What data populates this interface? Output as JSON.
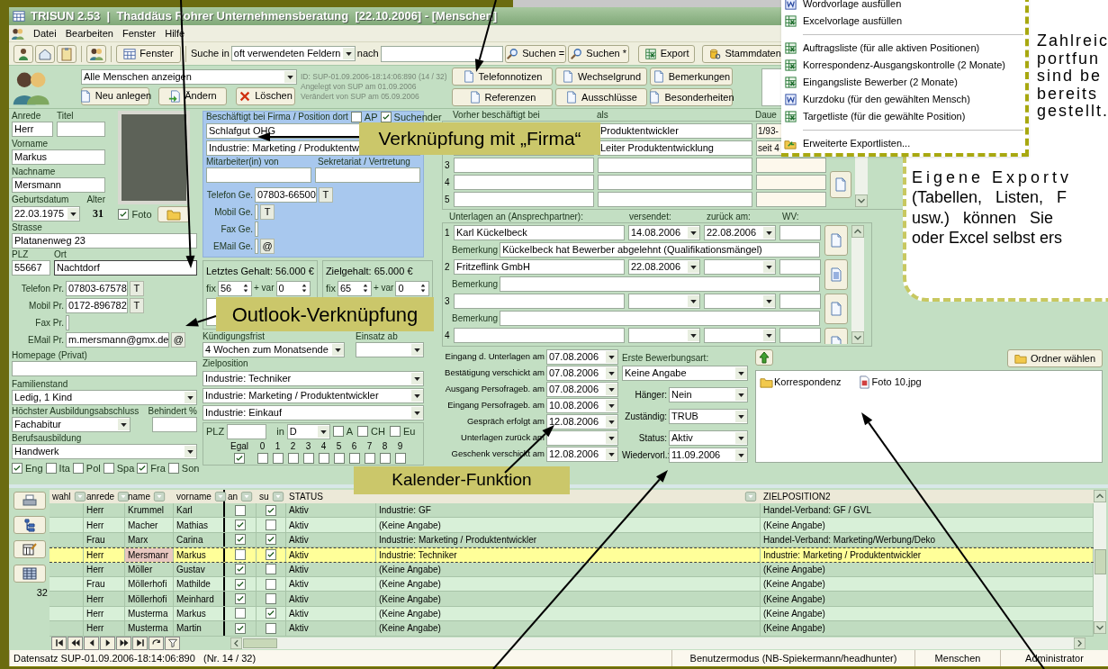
{
  "window": {
    "title": "TRISUN 2.53  |  Thaddäus Rohrer Unternehmensberatung  [22.10.2006] - [Menschen]"
  },
  "menu": [
    "Datei",
    "Bearbeiten",
    "Fenster",
    "Hilfe"
  ],
  "toolbar": {
    "fenster_button": "Fenster",
    "search_in_label": "Suche in",
    "search_in_value": "oft verwendeten Feldern",
    "search_for_label": "nach",
    "buttons": [
      {
        "label": "Suchen =",
        "kind": "search"
      },
      {
        "label": "Suchen *",
        "kind": "search"
      },
      {
        "label": "Export",
        "kind": "sheet"
      },
      {
        "label": "Stammdaten",
        "kind": "database"
      }
    ]
  },
  "record_bar": {
    "filter": "Alle Menschen anzeigen",
    "actions": [
      {
        "label": "Neu anlegen",
        "kind": "new"
      },
      {
        "label": "Ändern",
        "kind": "edit"
      },
      {
        "label": "Löschen",
        "kind": "delete"
      }
    ],
    "info": [
      "ID: SUP-01.09.2006-18:14:06:890  (14 / 32)",
      "Angelegt von SUP am 01.09.2006",
      "Verändert von SUP am 05.09.2006"
    ],
    "note_buttons": [
      "Telefonnotizen",
      "Wechselgrund",
      "Bemerkungen",
      "Referenzen",
      "Ausschlüsse",
      "Besonderheiten"
    ]
  },
  "person": {
    "anrede": {
      "label": "Anrede",
      "value": "Herr"
    },
    "titel": {
      "label": "Titel"
    },
    "vorname": {
      "label": "Vorname",
      "value": "Markus"
    },
    "nachname": {
      "label": "Nachname",
      "value": "Mersmann"
    },
    "geburtsdatum": {
      "label": "Geburtsdatum",
      "value": "22.03.1975"
    },
    "alter": {
      "label": "Alter",
      "value": "31"
    },
    "foto": {
      "label": "Foto",
      "checked": true
    },
    "strasse": {
      "label": "Strasse",
      "value": "Platanenweg 23"
    },
    "plz": {
      "label": "PLZ",
      "value": "55667"
    },
    "ort": {
      "label": "Ort",
      "value": "Nachtdorf"
    },
    "contacts": [
      {
        "label": "Telefon Pr.",
        "value": "07803-67578",
        "action": "T"
      },
      {
        "label": "Mobil Pr.",
        "value": "0172-896782",
        "action": "T"
      },
      {
        "label": "Fax Pr."
      },
      {
        "label": "EMail Pr.",
        "value": "m.mersmann@gmx.de",
        "action": "@"
      }
    ],
    "homepage": {
      "label": "Homepage (Privat)"
    },
    "familienstand": {
      "label": "Familienstand",
      "value": "Ledig, 1 Kind"
    },
    "abschluss": {
      "label": "Höchster Ausbildungsabschluss",
      "value": "Fachabitur"
    },
    "behindert": {
      "label": "Behindert %"
    },
    "berufsausbildung": {
      "label": "Berufsausbildung",
      "value": "Handwerk"
    },
    "languages": [
      {
        "label": "Eng",
        "checked": true
      },
      {
        "label": "Ita",
        "checked": false
      },
      {
        "label": "Pol",
        "checked": false
      },
      {
        "label": "Spa",
        "checked": false
      },
      {
        "label": "Fra",
        "checked": true
      },
      {
        "label": "Son",
        "checked": false
      }
    ]
  },
  "employer": {
    "header": "Beschäftigt bei Firma / Position dort",
    "ap": {
      "label": "AP",
      "checked": false
    },
    "suchender": {
      "label": "Suchender",
      "checked": true
    },
    "firma": "Schlafgut OHG",
    "position": "Industrie: Marketing / Produktentw",
    "mitarbeiter_label": "Mitarbeiter(in) von",
    "sekretariat_label": "Sekretariat / Vertretung",
    "contacts": [
      {
        "label": "Telefon Ge.",
        "value": "07803-66500",
        "action": "T"
      },
      {
        "label": "Mobil Ge.",
        "action": "T"
      },
      {
        "label": "Fax Ge."
      },
      {
        "label": "EMail Ge.",
        "action": "@"
      }
    ]
  },
  "salary": [
    {
      "title": "Letztes Gehalt: 56.000 €",
      "fix_label": "fix",
      "fix": "56",
      "var_label": "+ var",
      "var": "0"
    },
    {
      "title": "Zielgehalt: 65.000 €",
      "fix_label": "fix",
      "fix": "65",
      "var_label": "+ var",
      "var": "0"
    }
  ],
  "kuendigung": {
    "label": "Kündigungsfrist",
    "value": "4 Wochen zum Monatsende"
  },
  "einsatz": {
    "label": "Einsatz ab"
  },
  "zielposition": {
    "label": "Zielposition",
    "values": [
      "Industrie: Techniker",
      "Industrie: Marketing / Produktentwickler",
      "Industrie: Einkauf"
    ]
  },
  "region": {
    "plz_label": "PLZ",
    "in_label": "in",
    "country": "D",
    "areas": [
      {
        "label": "A",
        "checked": false
      },
      {
        "label": "CH",
        "checked": false
      },
      {
        "label": "Eu",
        "checked": false
      }
    ],
    "digits": [
      {
        "label": "Egal",
        "checked": true
      },
      {
        "label": "0",
        "checked": false
      },
      {
        "label": "1",
        "checked": false
      },
      {
        "label": "2",
        "checked": false
      },
      {
        "label": "3",
        "checked": false
      },
      {
        "label": "4",
        "checked": false
      },
      {
        "label": "5",
        "checked": false
      },
      {
        "label": "6",
        "checked": false
      },
      {
        "label": "7",
        "checked": false
      },
      {
        "label": "8",
        "checked": false
      },
      {
        "label": "9",
        "checked": false
      }
    ]
  },
  "previous_jobs": {
    "headers": [
      "Vorher beschäftigt bei",
      "als",
      "Daue"
    ],
    "rows": [
      {
        "als": "Produktentwickler",
        "dauer": "1/93-"
      },
      {
        "als": "Leiter Produktentwicklung",
        "dauer": "seit 4"
      },
      {
        "number": "3"
      },
      {
        "number": "4"
      },
      {
        "number": "5"
      }
    ]
  },
  "documents": {
    "headers": [
      "Unterlagen an (Ansprechpartner):",
      "versendet:",
      "zurück am:",
      "WV:"
    ],
    "rows": [
      {
        "number": "1",
        "recipient": "Karl Kückelbeck",
        "sent": "14.08.2006",
        "returned": "22.08.2006",
        "remark_label": "Bemerkung",
        "remark": "Kückelbeck hat Bewerber abgelehnt (Qualifikationsmängel)"
      },
      {
        "number": "2",
        "recipient": "Fritzeflink GmbH",
        "sent": "22.08.2006",
        "remark_label": "Bemerkung"
      },
      {
        "number": "3",
        "remark_label": "Bemerkung"
      },
      {
        "number": "4"
      }
    ]
  },
  "dates": [
    {
      "label": "Eingang d. Unterlagen am",
      "value": "07.08.2006"
    },
    {
      "label": "Bestätigung verschickt am",
      "value": "07.08.2006"
    },
    {
      "label": "Ausgang Persofrageb. am",
      "value": "07.08.2006"
    },
    {
      "label": "Eingang Persofrageb. am",
      "value": "10.08.2006"
    },
    {
      "label": "Gespräch erfolgt am",
      "value": "12.08.2006"
    },
    {
      "label": "Unterlagen zurück am"
    },
    {
      "label": "Geschenk verschickt am",
      "value": "12.08.2006"
    }
  ],
  "application": {
    "type_label": "Erste Bewerbungsart:",
    "type": "Keine Angabe",
    "fields": [
      {
        "label": "Hänger:",
        "value": "Nein"
      },
      {
        "label": "Zuständig:",
        "value": "TRUB"
      },
      {
        "label": "Status:",
        "value": "Aktiv"
      },
      {
        "label": "Wiedervorl.:",
        "value": "11.09.2006"
      }
    ]
  },
  "files": {
    "folder_button": "Ordner wählen",
    "items": [
      {
        "name": "Korrespondenz",
        "kind": "folder"
      },
      {
        "name": "Foto 10.jpg",
        "kind": "image"
      }
    ]
  },
  "grid": {
    "count": "32",
    "columns": [
      {
        "label": "wahl",
        "filter": true
      },
      {
        "label": "anrede",
        "filter": true
      },
      {
        "label": "name",
        "filter": true
      },
      {
        "label": "vorname",
        "filter": true
      },
      {
        "label": "an",
        "filter": true
      },
      {
        "label": "su",
        "filter": true
      },
      {
        "label": "STATUS",
        "filter": false
      },
      {
        "filter": true
      },
      {
        "label": "ZIELPOSITION2",
        "filter": false
      }
    ],
    "rows": [
      {
        "anrede": "Herr",
        "name": "Krummel",
        "vorname": "Karl",
        "an": false,
        "su": true,
        "status": "Aktiv",
        "column_8": "Industrie: GF",
        "zielposition2": "Handel-Verband: GF / GVL",
        "selected": false
      },
      {
        "anrede": "Herr",
        "name": "Macher",
        "vorname": "Mathias",
        "an": true,
        "su": false,
        "status": "Aktiv",
        "column_8": "(Keine Angabe)",
        "zielposition2": "(Keine Angabe)",
        "selected": false
      },
      {
        "anrede": "Frau",
        "name": "Marx",
        "vorname": "Carina",
        "an": true,
        "su": true,
        "status": "Aktiv",
        "column_8": "Industrie: Marketing / Produktentwickler",
        "zielposition2": "Handel-Verband: Marketing/Werbung/Deko",
        "selected": false
      },
      {
        "anrede": "Herr",
        "name": "Mersmanr",
        "vorname": "Markus",
        "an": false,
        "su": true,
        "status": "Aktiv",
        "column_8": "Industrie: Techniker",
        "zielposition2": "Industrie: Marketing / Produktentwickler",
        "selected": true
      },
      {
        "anrede": "Herr",
        "name": "Möller",
        "vorname": "Gustav",
        "an": true,
        "su": false,
        "status": "Aktiv",
        "column_8": "(Keine Angabe)",
        "zielposition2": "(Keine Angabe)",
        "selected": false
      },
      {
        "anrede": "Frau",
        "name": "Möllerhofi",
        "vorname": "Mathilde",
        "an": true,
        "su": false,
        "status": "Aktiv",
        "column_8": "(Keine Angabe)",
        "zielposition2": "(Keine Angabe)",
        "selected": false
      },
      {
        "anrede": "Herr",
        "name": "Möllerhofi",
        "vorname": "Meinhard",
        "an": true,
        "su": false,
        "status": "Aktiv",
        "column_8": "(Keine Angabe)",
        "zielposition2": "(Keine Angabe)",
        "selected": false
      },
      {
        "anrede": "Herr",
        "name": "Musterma",
        "vorname": "Markus",
        "an": false,
        "su": true,
        "status": "Aktiv",
        "column_8": "(Keine Angabe)",
        "zielposition2": "(Keine Angabe)",
        "selected": false
      },
      {
        "anrede": "Herr",
        "name": "Musterma",
        "vorname": "Martin",
        "an": true,
        "su": false,
        "status": "Aktiv",
        "column_8": "(Keine Angabe)",
        "zielposition2": "(Keine Angabe)",
        "selected": false
      }
    ]
  },
  "status_bar": [
    "Datensatz SUP-01.09.2006-18:14:06:890   (Nr. 14 / 32)",
    "Benutzermodus (NB-Spiekermann/headhunter)",
    "Menschen",
    "Administrator"
  ],
  "export_menu": [
    {
      "label": "Wordvorlage ausfüllen",
      "kind": "page"
    },
    {
      "label": "Excelvorlage ausfüllen",
      "kind": "sheet"
    },
    {
      "kind": "separator"
    },
    {
      "label": "Auftragsliste (für alle aktiven Positionen)",
      "kind": "sheet"
    },
    {
      "label": "Korrespondenz-Ausgangskontrolle (2 Monate)",
      "kind": "sheet"
    },
    {
      "label": "Eingangsliste Bewerber (2 Monate)",
      "kind": "sheet"
    },
    {
      "label": "Kurzdoku (für den gewählten Mensch)",
      "kind": "page"
    },
    {
      "label": "Targetliste (für die gewählte Position)",
      "kind": "sheet"
    },
    {
      "kind": "separator"
    },
    {
      "label": "Erweiterte Exportlisten...",
      "kind": "extended"
    }
  ],
  "callout": {
    "lines_top": [
      "Zahlreic",
      "portfun",
      "sind be",
      "bereits",
      "gestellt."
    ],
    "lines_bottom": [
      "Eigene Exportv",
      "(Tabellen, Listen, F",
      "usw.) können Sie",
      "oder Excel selbst ers"
    ]
  },
  "annotations": [
    "Verknüpfung mit „Firma“",
    "Outlook-Verknüpfung",
    "Kalender-Funktion"
  ]
}
